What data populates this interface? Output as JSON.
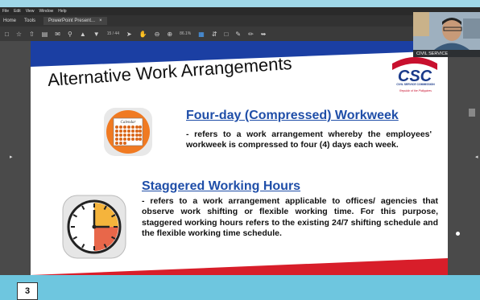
{
  "menubar": {
    "items": [
      "File",
      "Edit",
      "View",
      "Window",
      "Help"
    ]
  },
  "tabs": {
    "home": "Home",
    "tools": "Tools",
    "doc": "PowerPoint Present...",
    "close": "×"
  },
  "toolbar": {
    "page_current": "15",
    "page_total": "/ 44",
    "zoom": "86.1%"
  },
  "slide": {
    "title": "Alternative Work Arrangements",
    "logo": {
      "mark": "CSC",
      "line1": "CIVIL SERVICE COMMISSION",
      "line2": "Republic of the Philippines"
    },
    "calendar_label": "Calendar",
    "section1": {
      "heading": "Four-day (Compressed) Workweek",
      "body": "- refers to a work arrangement whereby the employees' workweek is compressed to four (4) days each week."
    },
    "section2": {
      "heading": "Staggered Working Hours",
      "body": "- refers to a work arrangement applicable to offices/ agencies that observe work shifting or flexible working time. For this purpose, staggered working hours refers to the existing 24/7 shifting schedule and the flexible working time schedule."
    },
    "number": "3"
  },
  "video": {
    "participant": "CIVIL SERVICE"
  },
  "colors": {
    "band_blue": "#1b3fa3",
    "band_red": "#d81e2a",
    "heading_blue": "#1f4ea8",
    "calendar_orange": "#f07a22"
  }
}
